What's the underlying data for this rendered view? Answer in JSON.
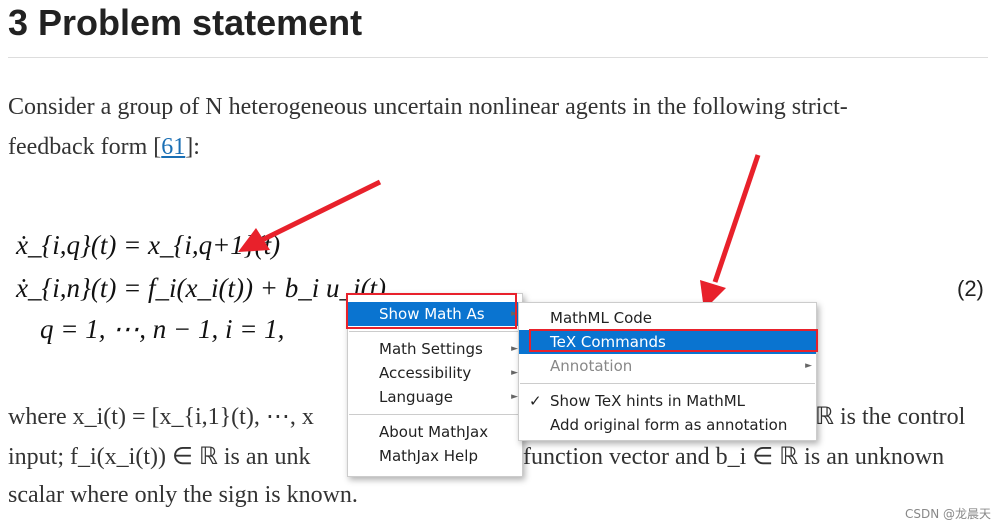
{
  "heading": "3 Problem statement",
  "intro": {
    "line1": "Consider a group of N heterogeneous uncertain nonlinear agents in the following strict-",
    "line2_pre": "feedback form [",
    "ref": "61",
    "line2_post": "]:"
  },
  "equations": {
    "eq1": "ẋ_{i,q}(t) = x_{i,q+1}(t)",
    "eq2": "ẋ_{i,n}(t) = f_i(x_i(t)) + b_i u_i(t),",
    "eq3": "q = 1, ⋯, n − 1,  i = 1,",
    "number": "(2)"
  },
  "after": {
    "l1a": "where x_i(t) = [x_{i,1}(t), ⋯, x",
    "l1b": "ℝ is the control",
    "l2a": "input; f_i(x_i(t)) ∈ ℝ is an unk",
    "l2b": "function vector and b_i ∈ ℝ is an unknown",
    "l3": "scalar where only the sign is known."
  },
  "context_menu": {
    "items": [
      {
        "label": "Show Math As",
        "submenu": true,
        "highlighted": true
      },
      {
        "label": "Math Settings",
        "submenu": true
      },
      {
        "label": "Accessibility",
        "submenu": true
      },
      {
        "label": "Language",
        "submenu": true
      },
      {
        "label": "About MathJax"
      },
      {
        "label": "MathJax Help"
      }
    ]
  },
  "submenu": {
    "items": [
      {
        "label": "MathML Code"
      },
      {
        "label": "TeX Commands",
        "highlighted": true
      },
      {
        "label": "Annotation",
        "disabled": true,
        "submenu": true
      },
      {
        "label": "Show TeX hints in MathML",
        "checked": true
      },
      {
        "label": "Add original form as annotation"
      }
    ]
  },
  "check_mark": "✓",
  "submenu_arrow": "►",
  "watermark": "CSDN @龙晨天",
  "colors": {
    "highlight": "#0a74d0",
    "annotation": "#e8212b",
    "link": "#1a6fb4"
  }
}
